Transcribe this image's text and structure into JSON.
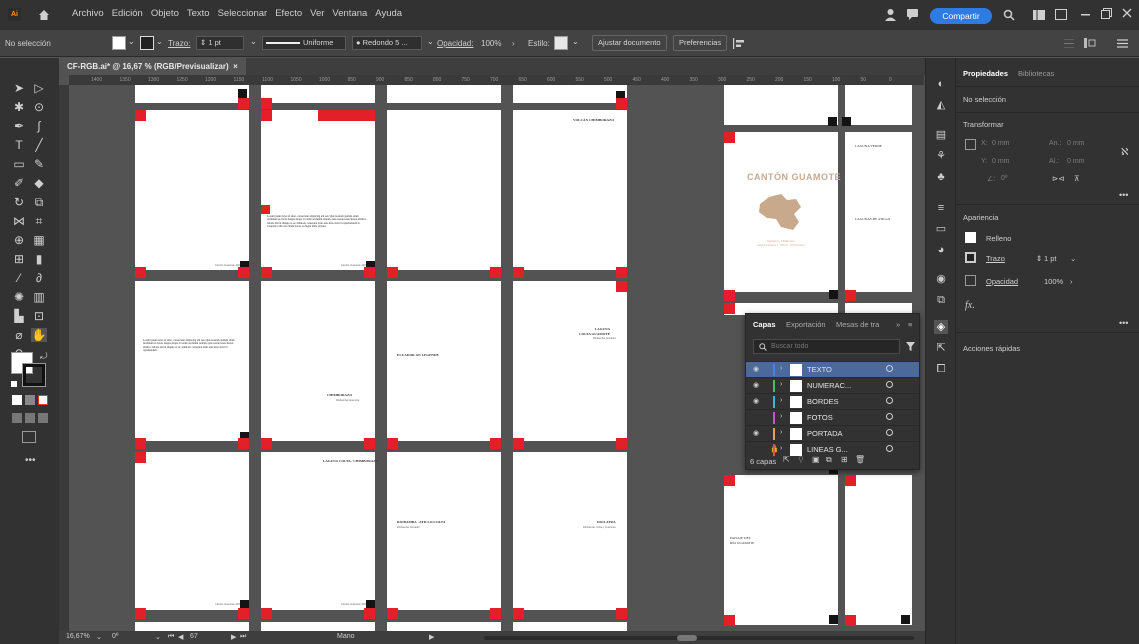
{
  "app": {
    "logo": "Ai"
  },
  "menu": [
    "Archivo",
    "Edición",
    "Objeto",
    "Texto",
    "Seleccionar",
    "Efecto",
    "Ver",
    "Ventana",
    "Ayuda"
  ],
  "share_label": "Compartir",
  "control": {
    "selection": "No selección",
    "stroke_label": "Trazo:",
    "stroke_value": "1 pt",
    "profile": "Uniforme",
    "brush": "Redondo 5 ...",
    "opacity_label": "Opacidad:",
    "opacity_value": "100%",
    "style_label": "Estilo:",
    "fit_button": "Ajustar documento",
    "prefs_button": "Preferencias"
  },
  "document": {
    "tab": "CF-RGB.ai* @ 16,67 % (RGB/Previsualizar)",
    "close": "×"
  },
  "ruler_ticks": [
    "1400",
    "1350",
    "1300",
    "1250",
    "1200",
    "1150",
    "1100",
    "1050",
    "1000",
    "950",
    "900",
    "850",
    "800",
    "750",
    "700",
    "650",
    "600",
    "550",
    "500",
    "450",
    "400",
    "350",
    "300",
    "250",
    "200",
    "150",
    "100",
    "50",
    "0"
  ],
  "artboards": {
    "volcan": "VOLCÁN CHIMBORAZO",
    "canton": "CANTÓN GUAMOTE",
    "canton_sub": "Ingeniería - Chimborazo\nCantón Guamote 2 · 000 m · 2023 Febrero",
    "laguna_verde": "LAGUNA VERDE",
    "laguna_atillo": "LAGUNAS DE ATILLO",
    "laguna_colta": "LAGUNA\nCOLTA GUAMOTE",
    "laguna_colta_sub": "Riobamba, Ecuador",
    "ecuador": "ECUADOR ON LEGENDE",
    "chimborazo": "CHIMBORAZO",
    "chimborazo_sub": "Riobamba Guamote",
    "lago": "LAGUNA COLTA / CHIMBORAZO",
    "riobamba": "RIOBAMBA - ATILLO/COLTA",
    "riobamba_sub": "Riobamba, Ecuador",
    "idolatra": "IDOLATRA",
    "idolatra_sub": "Riobamba, Colta y Guamote",
    "paisaje": "PAISAJE DEL\nRÍO GUAMOTE",
    "para1": "Lorem ipsum dolor sit amet, consectetur adipiscing elit sed. Quis nostrum quidem etiam incididunt et dolore magna aliqua. Ut enim ad minim veniam, quis nostrud exercitation ullamco laboris nisi ut aliquip ex ea commodo consequat. Duis aute irure dolor in reprehenderit in voluptate velit esse cillum dolore eu fugiat nulla pariatur.",
    "para2": "Lorem ipsum dolor sit amet, consectetur adipiscing elit sed. Quis nostrum quidem etiam incididunt et dolore magna aliqua. Ut enim ad minim veniam, quis nostrud exercitation ullamco laboris nisi ut aliquip ex ea commodo consequat. Duis aute irure dolor in reprehenderit.",
    "footer": "Cantón Guamote 2023"
  },
  "status": {
    "zoom": "16,67%",
    "angle": "0º",
    "page": "67",
    "tool": "Mano"
  },
  "properties": {
    "tab_props": "Propiedades",
    "tab_libs": "Bibliotecas",
    "no_selection": "No selección",
    "transform": "Transformar",
    "x_label": "X:",
    "x_val": "0 mm",
    "y_label": "Y:",
    "y_val": "0 mm",
    "w_label": "An.:",
    "w_val": "0 mm",
    "h_label": "Al.:",
    "h_val": "0 mm",
    "angle_label": "∠:",
    "angle_val": "0º",
    "appearance": "Apariencia",
    "fill": "Relleno",
    "stroke": "Trazo",
    "stroke_val": "1 pt",
    "opacity": "Opacidad",
    "opacity_val": "100%",
    "fx": "fx.",
    "quick": "Acciones rápidas"
  },
  "layers": {
    "tabs": [
      "Capas",
      "Exportación",
      "Mesas de tra"
    ],
    "search_placeholder": "Buscar todo",
    "rows": [
      {
        "name": "TEXTO",
        "color": "#4f7fe0",
        "visible": true,
        "locked": false,
        "selected": true
      },
      {
        "name": "NUMERAC...",
        "color": "#3fbf6f",
        "visible": true,
        "locked": false,
        "selected": false
      },
      {
        "name": "BORDES",
        "color": "#33b8d8",
        "visible": true,
        "locked": false,
        "selected": false
      },
      {
        "name": "FOTOS",
        "color": "#cc4fd8",
        "visible": false,
        "locked": false,
        "selected": false
      },
      {
        "name": "PORTADA",
        "color": "#e0a34f",
        "visible": true,
        "locked": false,
        "selected": false
      },
      {
        "name": "LINEAS G...",
        "color": "#e04f4f",
        "visible": false,
        "locked": true,
        "selected": false
      }
    ],
    "count": "6 capas"
  }
}
